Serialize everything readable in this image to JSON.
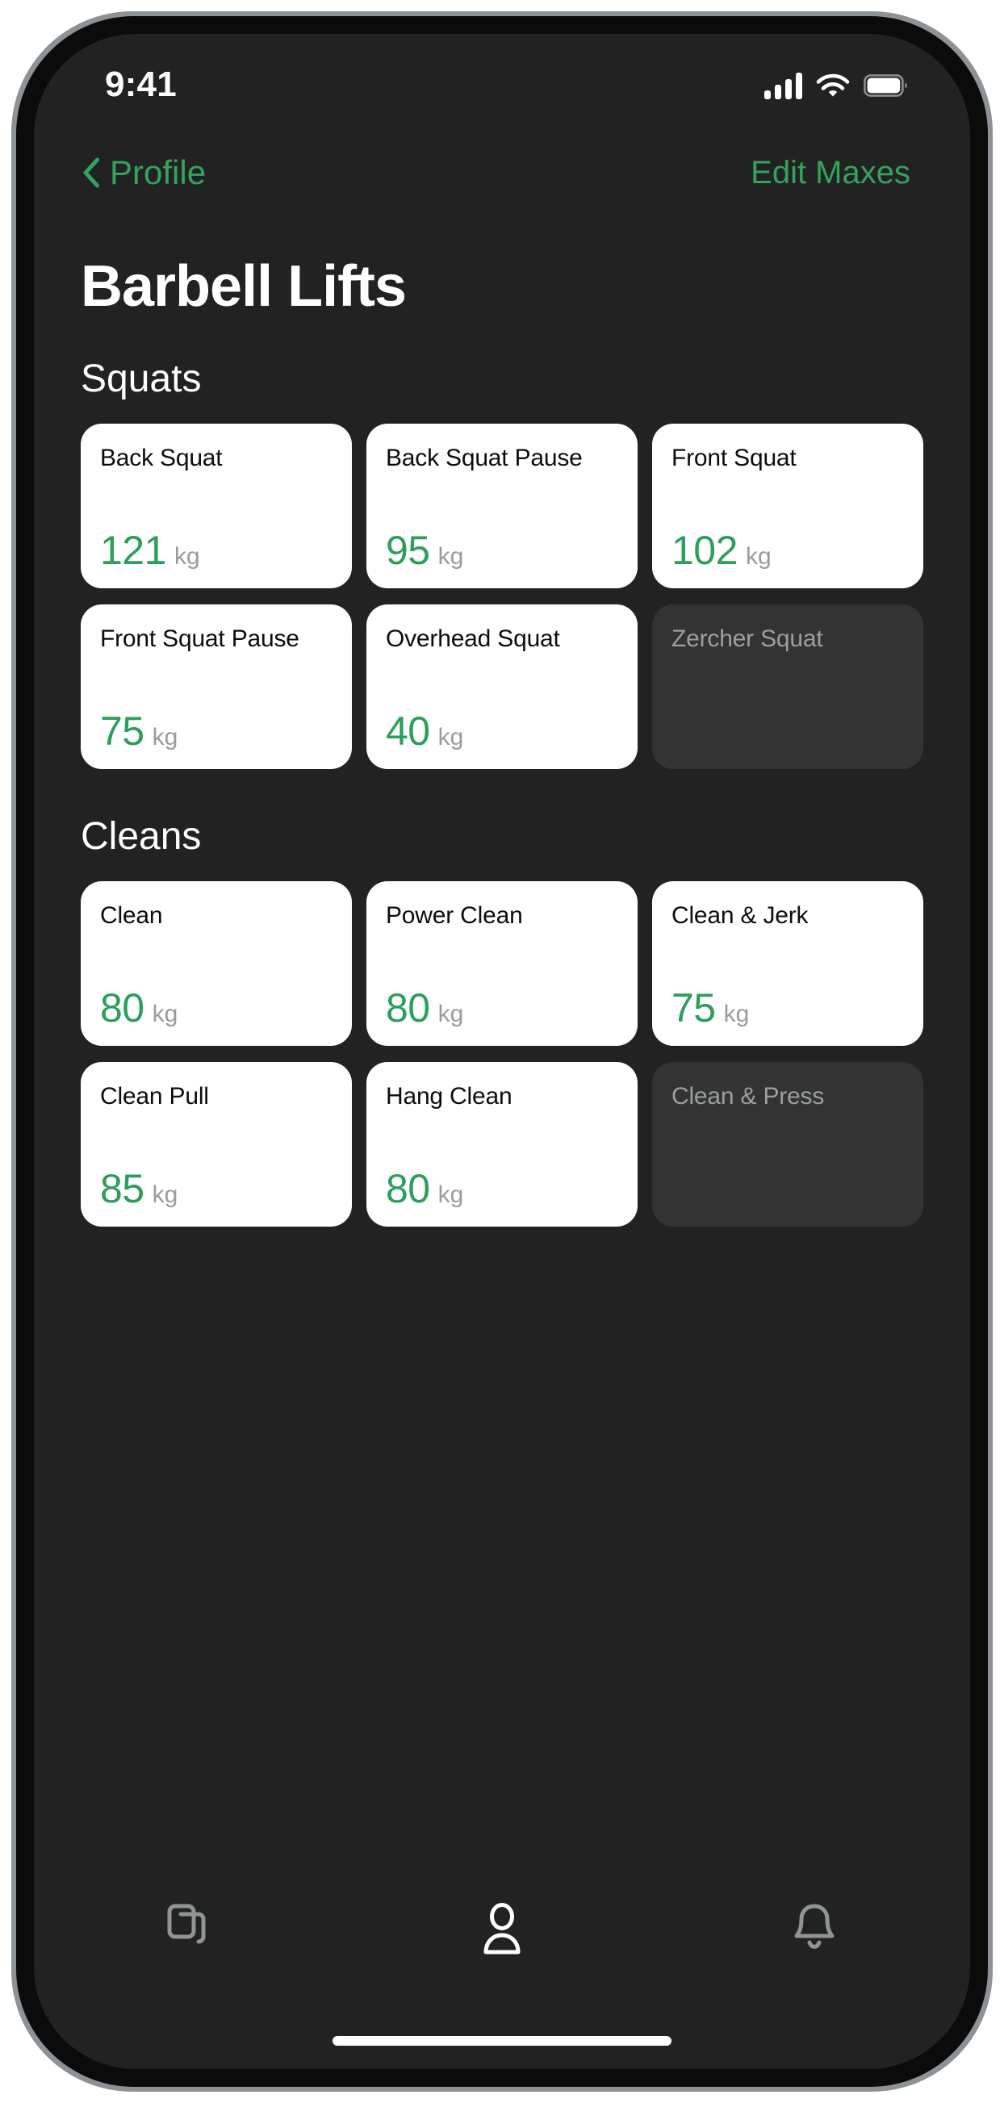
{
  "status_bar": {
    "time": "9:41",
    "cellular_icon": "signal-bars-icon",
    "wifi_icon": "wifi-icon",
    "battery_icon": "battery-icon"
  },
  "nav_bar": {
    "back_icon": "chevron-left-icon",
    "back_label": "Profile",
    "action_label": "Edit Maxes"
  },
  "page": {
    "title": "Barbell Lifts"
  },
  "colors": {
    "accent_green": "#34a35c",
    "value_green": "#2e9e5b",
    "screen_background": "#222222",
    "card_background": "#ffffff",
    "empty_card_background": "#333333",
    "unit_gray": "#9b9b9b",
    "empty_text_gray": "#9aa0a0"
  },
  "sections": [
    {
      "title": "Squats",
      "cards": [
        {
          "name": "Back Squat",
          "value": "121",
          "unit": "kg",
          "empty": false
        },
        {
          "name": "Back Squat Pause",
          "value": "95",
          "unit": "kg",
          "empty": false
        },
        {
          "name": "Front Squat",
          "value": "102",
          "unit": "kg",
          "empty": false
        },
        {
          "name": "Front Squat Pause",
          "value": "75",
          "unit": "kg",
          "empty": false
        },
        {
          "name": "Overhead Squat",
          "value": "40",
          "unit": "kg",
          "empty": false
        },
        {
          "name": "Zercher Squat",
          "value": "",
          "unit": "",
          "empty": true
        }
      ]
    },
    {
      "title": "Cleans",
      "cards": [
        {
          "name": "Clean",
          "value": "80",
          "unit": "kg",
          "empty": false
        },
        {
          "name": "Power Clean",
          "value": "80",
          "unit": "kg",
          "empty": false
        },
        {
          "name": "Clean & Jerk",
          "value": "75",
          "unit": "kg",
          "empty": false
        },
        {
          "name": "Clean Pull",
          "value": "85",
          "unit": "kg",
          "empty": false
        },
        {
          "name": "Hang Clean",
          "value": "80",
          "unit": "kg",
          "empty": false
        },
        {
          "name": "Clean & Press",
          "value": "",
          "unit": "",
          "empty": true
        }
      ]
    }
  ],
  "tab_bar": {
    "tabs": [
      {
        "icon": "cards-stack-icon",
        "active": false
      },
      {
        "icon": "person-icon",
        "active": true
      },
      {
        "icon": "bell-icon",
        "active": false
      }
    ]
  },
  "home_indicator": "home-indicator"
}
